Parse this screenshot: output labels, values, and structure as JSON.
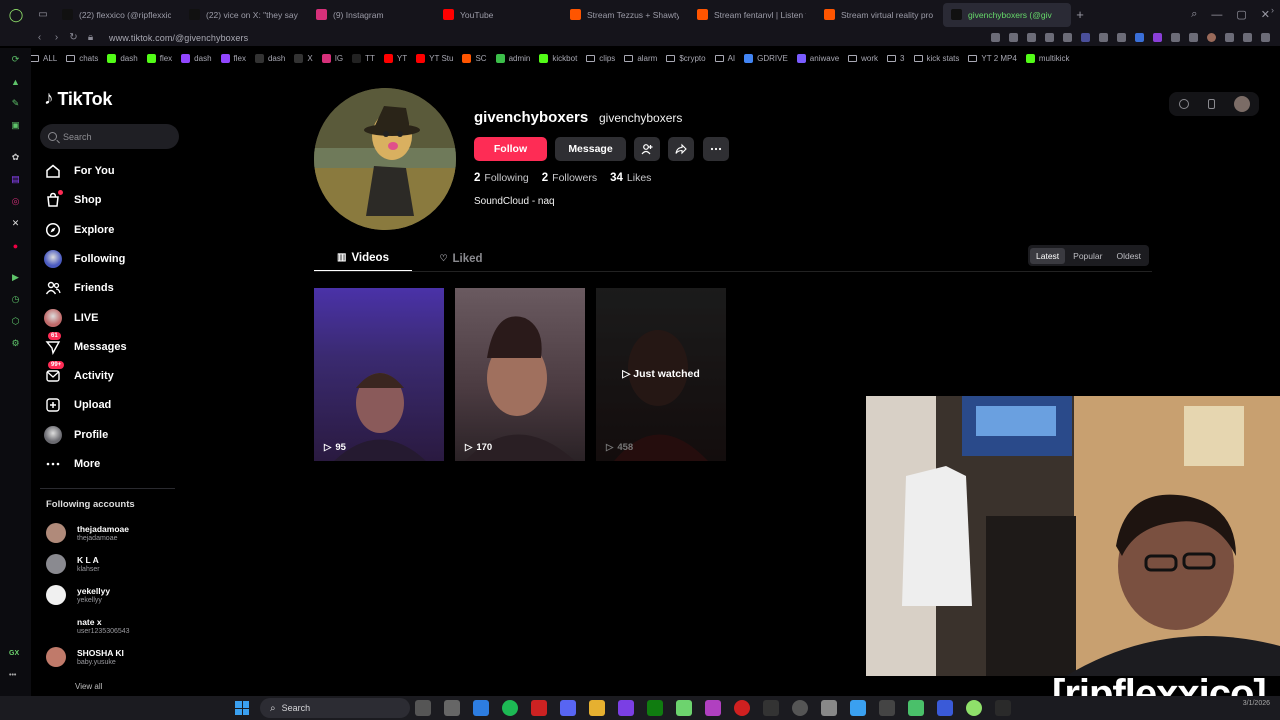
{
  "browser": {
    "tabs": [
      {
        "title": "(22) flexxico (@ripflexxico",
        "favicon": "x-logo",
        "color": "#111111"
      },
      {
        "title": "(22) vice on X: \"they sayin",
        "favicon": "x-logo",
        "color": "#111111"
      },
      {
        "title": "(9) Instagram",
        "favicon": "instagram-icon",
        "color": "#d6307a"
      },
      {
        "title": "YouTube",
        "favicon": "youtube-icon",
        "color": "#ff0000"
      },
      {
        "title": "Stream Tezzus + Shawty",
        "favicon": "soundcloud-icon",
        "color": "#ff5500"
      },
      {
        "title": "Stream fentanvl | Listen to",
        "favicon": "soundcloud-icon",
        "color": "#ff5500"
      },
      {
        "title": "Stream virtual reality prod",
        "favicon": "soundcloud-icon",
        "color": "#ff5500"
      },
      {
        "title": "givenchyboxers (@giv",
        "favicon": "tiktok-icon",
        "color": "#111111",
        "active": true
      }
    ],
    "url": "www.tiktok.com/@givenchyboxers",
    "bookmarks": [
      {
        "label": "ALL",
        "icon": "folder"
      },
      {
        "label": "chats",
        "icon": "folder"
      },
      {
        "label": "dash",
        "icon": "kick",
        "color": "#53fc18"
      },
      {
        "label": "flex",
        "icon": "kick",
        "color": "#53fc18"
      },
      {
        "label": "dash",
        "icon": "twitch",
        "color": "#9146ff"
      },
      {
        "label": "flex",
        "icon": "twitch",
        "color": "#9146ff"
      },
      {
        "label": "dash",
        "icon": "x",
        "color": "#333333"
      },
      {
        "label": "X",
        "icon": "x",
        "color": "#333333"
      },
      {
        "label": "IG",
        "icon": "instagram",
        "color": "#d6307a"
      },
      {
        "label": "TT",
        "icon": "tiktok",
        "color": "#222222"
      },
      {
        "label": "YT",
        "icon": "youtube",
        "color": "#ff0000"
      },
      {
        "label": "YT Stu",
        "icon": "youtube",
        "color": "#ff0000"
      },
      {
        "label": "SC",
        "icon": "soundcloud",
        "color": "#ff5500"
      },
      {
        "label": "admin",
        "icon": "green",
        "color": "#3cbf4a"
      },
      {
        "label": "kickbot",
        "icon": "kick",
        "color": "#53fc18"
      },
      {
        "label": "clips",
        "icon": "folder"
      },
      {
        "label": "alarm",
        "icon": "folder"
      },
      {
        "label": "$crypto",
        "icon": "folder"
      },
      {
        "label": "AI",
        "icon": "folder"
      },
      {
        "label": "GDRIVE",
        "icon": "google",
        "color": "#4285f4"
      },
      {
        "label": "aniwave",
        "icon": "aniwave",
        "color": "#7a5cff"
      },
      {
        "label": "work",
        "icon": "folder"
      },
      {
        "label": "3",
        "icon": "folder"
      },
      {
        "label": "kick stats",
        "icon": "folder"
      },
      {
        "label": "YT 2 MP4",
        "icon": "folder"
      },
      {
        "label": "multikick",
        "icon": "kick",
        "color": "#53fc18"
      }
    ]
  },
  "tiktok": {
    "logo_text": "TikTok",
    "search_placeholder": "Search",
    "nav": [
      {
        "label": "For You",
        "icon": "home-icon"
      },
      {
        "label": "Shop",
        "icon": "shop-icon"
      },
      {
        "label": "Explore",
        "icon": "compass-icon"
      },
      {
        "label": "Following",
        "icon": "avatar"
      },
      {
        "label": "Friends",
        "icon": "friends-icon"
      },
      {
        "label": "LIVE",
        "icon": "avatar"
      },
      {
        "label": "Messages",
        "icon": "messages-icon",
        "badge": "61"
      },
      {
        "label": "Activity",
        "icon": "activity-icon",
        "badge": "99+"
      },
      {
        "label": "Upload",
        "icon": "upload-icon"
      },
      {
        "label": "Profile",
        "icon": "avatar"
      },
      {
        "label": "More",
        "icon": "more-icon"
      }
    ],
    "following_accounts_title": "Following accounts",
    "following_accounts": [
      {
        "name": "thejadamoae",
        "handle": "thejadamoae"
      },
      {
        "name": "K L A",
        "handle": "klahser"
      },
      {
        "name": "yekellyy",
        "handle": "yekellyy"
      },
      {
        "name": "nate x",
        "handle": "user1235306543"
      },
      {
        "name": "SHOSHA KI",
        "handle": "baby.yusuke"
      }
    ],
    "view_all": "View all"
  },
  "profile": {
    "username": "givenchyboxers",
    "nickname": "givenchyboxers",
    "follow_label": "Follow",
    "message_label": "Message",
    "following_count": "2",
    "following_label": "Following",
    "followers_count": "2",
    "followers_label": "Followers",
    "likes_count": "34",
    "likes_label": "Likes",
    "bio": "SoundCloud - naq",
    "tabs": {
      "videos": "Videos",
      "liked": "Liked"
    },
    "sort": [
      "Latest",
      "Popular",
      "Oldest"
    ],
    "videos": [
      {
        "views": "95"
      },
      {
        "views": "170"
      },
      {
        "views": "458",
        "overlay": "Just watched"
      }
    ]
  },
  "overlay": {
    "watermark": "[ripflexxico]"
  },
  "taskbar": {
    "search_label": "Search",
    "date": "3/1/2026"
  }
}
